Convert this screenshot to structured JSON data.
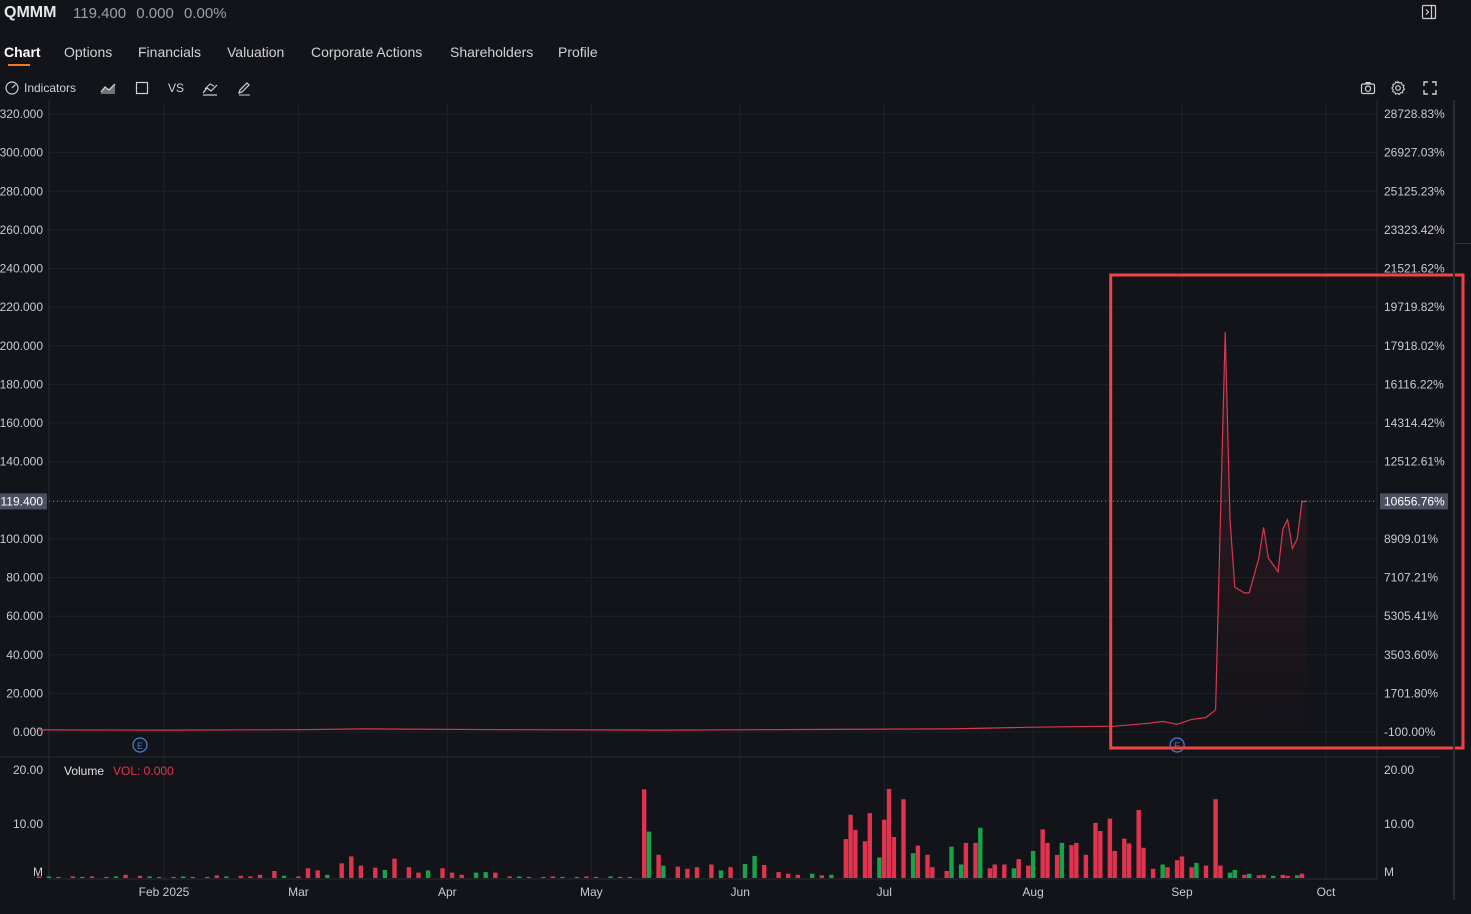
{
  "header": {
    "symbol": "QMMM",
    "price": "119.400",
    "change": "0.000",
    "change_pct": "0.00%"
  },
  "tabs": [
    {
      "label": "Chart",
      "active": true
    },
    {
      "label": "Options"
    },
    {
      "label": "Financials"
    },
    {
      "label": "Valuation"
    },
    {
      "label": "Corporate Actions"
    },
    {
      "label": "Shareholders"
    },
    {
      "label": "Profile"
    }
  ],
  "toolbar": {
    "indicators_label": "Indicators",
    "vs_label": "VS"
  },
  "colors": {
    "background": "#131419",
    "up": "#16a34a",
    "down": "#e0344e",
    "price_line": "#d9374f",
    "highlight_box": "#f04444",
    "earnings_marker": "#4d7fd6",
    "accent": "#f07a22"
  },
  "chart_data": {
    "type": "line",
    "x_ticks": [
      "Feb 2025",
      "Mar",
      "Apr",
      "May",
      "Jun",
      "Jul",
      "Aug",
      "Sep",
      "Oct"
    ],
    "ylim": [
      0,
      320
    ],
    "y_ticks_left": [
      "320.000",
      "300.000",
      "280.000",
      "260.000",
      "240.000",
      "220.000",
      "200.000",
      "180.000",
      "160.000",
      "140.000",
      "120.000",
      "100.000",
      "80.000",
      "60.000",
      "40.000",
      "20.000",
      "0.000"
    ],
    "y_ticks_right": [
      "28728.83%",
      "26927.03%",
      "25125.23%",
      "23323.42%",
      "21521.62%",
      "19719.82%",
      "17918.02%",
      "16116.22%",
      "14314.42%",
      "12512.61%",
      "10656.76%",
      "8909.01%",
      "7107.21%",
      "5305.41%",
      "3503.60%",
      "1701.80%",
      "-100.00%"
    ],
    "current_value_label": "119.400",
    "current_pct_label": "10656.76%",
    "current_value": 119.4,
    "earnings_marker_label": "E",
    "earnings_dates": [
      "2025-01-27",
      "2025-08-31"
    ],
    "series": [
      {
        "values": [
          {
            "date": "2025-01-06",
            "value": 1.1
          },
          {
            "date": "2025-02-01",
            "value": 1.0
          },
          {
            "date": "2025-03-01",
            "value": 1.2
          },
          {
            "date": "2025-03-15",
            "value": 1.6
          },
          {
            "date": "2025-04-15",
            "value": 1.2
          },
          {
            "date": "2025-05-15",
            "value": 1.0
          },
          {
            "date": "2025-06-15",
            "value": 1.3
          },
          {
            "date": "2025-07-15",
            "value": 1.6
          },
          {
            "date": "2025-08-01",
            "value": 2.5
          },
          {
            "date": "2025-08-18",
            "value": 3.0
          },
          {
            "date": "2025-08-25",
            "value": 4.5
          },
          {
            "date": "2025-08-28",
            "value": 5.5
          },
          {
            "date": "2025-08-31",
            "value": 4.0
          },
          {
            "date": "2025-09-03",
            "value": 6.5
          },
          {
            "date": "2025-09-06",
            "value": 7.5
          },
          {
            "date": "2025-09-08",
            "value": 11.5
          },
          {
            "date": "2025-09-09",
            "value": 110
          },
          {
            "date": "2025-09-10",
            "value": 207
          },
          {
            "date": "2025-09-11",
            "value": 110
          },
          {
            "date": "2025-09-12",
            "value": 75
          },
          {
            "date": "2025-09-14",
            "value": 72
          },
          {
            "date": "2025-09-15",
            "value": 72
          },
          {
            "date": "2025-09-17",
            "value": 90
          },
          {
            "date": "2025-09-18",
            "value": 106
          },
          {
            "date": "2025-09-19",
            "value": 90
          },
          {
            "date": "2025-09-21",
            "value": 83
          },
          {
            "date": "2025-09-22",
            "value": 105
          },
          {
            "date": "2025-09-23",
            "value": 110
          },
          {
            "date": "2025-09-24",
            "value": 95
          },
          {
            "date": "2025-09-25",
            "value": 100
          },
          {
            "date": "2025-09-26",
            "value": 119.4
          },
          {
            "date": "2025-09-27",
            "value": 119.4
          }
        ]
      }
    ],
    "highlight_range": {
      "start": "2025-08-18",
      "end": "2025-10-10"
    }
  },
  "volume": {
    "label": "Volume",
    "value_label": "VOL: 0.000",
    "ylim": [
      0,
      20
    ],
    "y_ticks_left": [
      "20.00",
      "10.00",
      "M"
    ],
    "y_ticks_right": [
      "20.00",
      "10.00",
      "M"
    ],
    "bars": [
      {
        "date": "2025-01-06",
        "value": 0.3,
        "dir": "down"
      },
      {
        "date": "2025-01-08",
        "value": 0.3,
        "dir": "up"
      },
      {
        "date": "2025-01-10",
        "value": 0.2,
        "dir": "down"
      },
      {
        "date": "2025-01-13",
        "value": 0.3,
        "dir": "down"
      },
      {
        "date": "2025-01-15",
        "value": 0.2,
        "dir": "up"
      },
      {
        "date": "2025-01-17",
        "value": 0.3,
        "dir": "down"
      },
      {
        "date": "2025-01-20",
        "value": 0.2,
        "dir": "down"
      },
      {
        "date": "2025-01-22",
        "value": 0.3,
        "dir": "up"
      },
      {
        "date": "2025-01-24",
        "value": 0.6,
        "dir": "down"
      },
      {
        "date": "2025-01-27",
        "value": 0.4,
        "dir": "down"
      },
      {
        "date": "2025-01-29",
        "value": 0.3,
        "dir": "up"
      },
      {
        "date": "2025-01-31",
        "value": 0.2,
        "dir": "down"
      },
      {
        "date": "2025-02-03",
        "value": 0.2,
        "dir": "down"
      },
      {
        "date": "2025-02-05",
        "value": 0.3,
        "dir": "up"
      },
      {
        "date": "2025-02-07",
        "value": 0.2,
        "dir": "down"
      },
      {
        "date": "2025-02-10",
        "value": 0.2,
        "dir": "down"
      },
      {
        "date": "2025-02-12",
        "value": 0.5,
        "dir": "down"
      },
      {
        "date": "2025-02-14",
        "value": 0.3,
        "dir": "up"
      },
      {
        "date": "2025-02-17",
        "value": 0.4,
        "dir": "down"
      },
      {
        "date": "2025-02-19",
        "value": 0.3,
        "dir": "down"
      },
      {
        "date": "2025-02-21",
        "value": 0.6,
        "dir": "down"
      },
      {
        "date": "2025-02-24",
        "value": 1.3,
        "dir": "down"
      },
      {
        "date": "2025-02-26",
        "value": 0.4,
        "dir": "up"
      },
      {
        "date": "2025-03-01",
        "value": 0.3,
        "dir": "down"
      },
      {
        "date": "2025-03-03",
        "value": 1.8,
        "dir": "down"
      },
      {
        "date": "2025-03-05",
        "value": 1.4,
        "dir": "down"
      },
      {
        "date": "2025-03-07",
        "value": 0.6,
        "dir": "up"
      },
      {
        "date": "2025-03-10",
        "value": 2.7,
        "dir": "down"
      },
      {
        "date": "2025-03-12",
        "value": 4.0,
        "dir": "down"
      },
      {
        "date": "2025-03-14",
        "value": 2.3,
        "dir": "down"
      },
      {
        "date": "2025-03-17",
        "value": 1.9,
        "dir": "down"
      },
      {
        "date": "2025-03-19",
        "value": 1.5,
        "dir": "up"
      },
      {
        "date": "2025-03-21",
        "value": 3.6,
        "dir": "down"
      },
      {
        "date": "2025-03-24",
        "value": 2.0,
        "dir": "down"
      },
      {
        "date": "2025-03-26",
        "value": 1.0,
        "dir": "down"
      },
      {
        "date": "2025-03-28",
        "value": 1.4,
        "dir": "up"
      },
      {
        "date": "2025-03-31",
        "value": 1.8,
        "dir": "down"
      },
      {
        "date": "2025-04-02",
        "value": 1.0,
        "dir": "down"
      },
      {
        "date": "2025-04-04",
        "value": 0.6,
        "dir": "down"
      },
      {
        "date": "2025-04-07",
        "value": 1.0,
        "dir": "up"
      },
      {
        "date": "2025-04-09",
        "value": 1.1,
        "dir": "up"
      },
      {
        "date": "2025-04-11",
        "value": 1.0,
        "dir": "down"
      },
      {
        "date": "2025-04-14",
        "value": 0.3,
        "dir": "down"
      },
      {
        "date": "2025-04-16",
        "value": 0.3,
        "dir": "up"
      },
      {
        "date": "2025-04-18",
        "value": 0.2,
        "dir": "down"
      },
      {
        "date": "2025-04-21",
        "value": 0.2,
        "dir": "down"
      },
      {
        "date": "2025-04-23",
        "value": 0.3,
        "dir": "down"
      },
      {
        "date": "2025-04-25",
        "value": 0.2,
        "dir": "up"
      },
      {
        "date": "2025-04-28",
        "value": 0.2,
        "dir": "down"
      },
      {
        "date": "2025-04-30",
        "value": 0.3,
        "dir": "down"
      },
      {
        "date": "2025-05-02",
        "value": 0.2,
        "dir": "down"
      },
      {
        "date": "2025-05-05",
        "value": 0.3,
        "dir": "up"
      },
      {
        "date": "2025-05-07",
        "value": 0.2,
        "dir": "down"
      },
      {
        "date": "2025-05-09",
        "value": 0.2,
        "dir": "down"
      },
      {
        "date": "2025-05-12",
        "value": 16.4,
        "dir": "down"
      },
      {
        "date": "2025-05-13",
        "value": 8.6,
        "dir": "up"
      },
      {
        "date": "2025-05-15",
        "value": 4.3,
        "dir": "down"
      },
      {
        "date": "2025-05-16",
        "value": 2.3,
        "dir": "up"
      },
      {
        "date": "2025-05-19",
        "value": 2.1,
        "dir": "down"
      },
      {
        "date": "2025-05-21",
        "value": 1.7,
        "dir": "down"
      },
      {
        "date": "2025-05-23",
        "value": 2.0,
        "dir": "down"
      },
      {
        "date": "2025-05-26",
        "value": 2.5,
        "dir": "down"
      },
      {
        "date": "2025-05-28",
        "value": 1.4,
        "dir": "up"
      },
      {
        "date": "2025-05-30",
        "value": 2.0,
        "dir": "down"
      },
      {
        "date": "2025-06-02",
        "value": 2.6,
        "dir": "up"
      },
      {
        "date": "2025-06-04",
        "value": 4.1,
        "dir": "up"
      },
      {
        "date": "2025-06-06",
        "value": 2.4,
        "dir": "down"
      },
      {
        "date": "2025-06-09",
        "value": 1.1,
        "dir": "down"
      },
      {
        "date": "2025-06-11",
        "value": 0.8,
        "dir": "down"
      },
      {
        "date": "2025-06-13",
        "value": 0.6,
        "dir": "down"
      },
      {
        "date": "2025-06-16",
        "value": 0.8,
        "dir": "up"
      },
      {
        "date": "2025-06-18",
        "value": 0.5,
        "dir": "down"
      },
      {
        "date": "2025-06-20",
        "value": 0.6,
        "dir": "up"
      },
      {
        "date": "2025-06-23",
        "value": 7.2,
        "dir": "down"
      },
      {
        "date": "2025-06-24",
        "value": 11.7,
        "dir": "down"
      },
      {
        "date": "2025-06-25",
        "value": 8.9,
        "dir": "down"
      },
      {
        "date": "2025-06-27",
        "value": 6.8,
        "dir": "down"
      },
      {
        "date": "2025-06-28",
        "value": 12.0,
        "dir": "down"
      },
      {
        "date": "2025-06-30",
        "value": 3.8,
        "dir": "up"
      },
      {
        "date": "2025-07-01",
        "value": 10.8,
        "dir": "down"
      },
      {
        "date": "2025-07-02",
        "value": 16.5,
        "dir": "down"
      },
      {
        "date": "2025-07-03",
        "value": 7.6,
        "dir": "down"
      },
      {
        "date": "2025-07-05",
        "value": 14.6,
        "dir": "down"
      },
      {
        "date": "2025-07-07",
        "value": 4.6,
        "dir": "up"
      },
      {
        "date": "2025-07-08",
        "value": 6.0,
        "dir": "down"
      },
      {
        "date": "2025-07-10",
        "value": 4.3,
        "dir": "down"
      },
      {
        "date": "2025-07-11",
        "value": 2.0,
        "dir": "down"
      },
      {
        "date": "2025-07-14",
        "value": 1.3,
        "dir": "down"
      },
      {
        "date": "2025-07-15",
        "value": 5.8,
        "dir": "up"
      },
      {
        "date": "2025-07-17",
        "value": 2.5,
        "dir": "up"
      },
      {
        "date": "2025-07-18",
        "value": 6.5,
        "dir": "down"
      },
      {
        "date": "2025-07-20",
        "value": 6.5,
        "dir": "down"
      },
      {
        "date": "2025-07-21",
        "value": 9.3,
        "dir": "up"
      },
      {
        "date": "2025-07-23",
        "value": 1.8,
        "dir": "down"
      },
      {
        "date": "2025-07-24",
        "value": 2.5,
        "dir": "down"
      },
      {
        "date": "2025-07-26",
        "value": 2.5,
        "dir": "down"
      },
      {
        "date": "2025-07-28",
        "value": 1.8,
        "dir": "up"
      },
      {
        "date": "2025-07-29",
        "value": 3.5,
        "dir": "down"
      },
      {
        "date": "2025-07-31",
        "value": 2.3,
        "dir": "down"
      },
      {
        "date": "2025-08-01",
        "value": 5.0,
        "dir": "up"
      },
      {
        "date": "2025-08-03",
        "value": 9.0,
        "dir": "down"
      },
      {
        "date": "2025-08-04",
        "value": 6.5,
        "dir": "down"
      },
      {
        "date": "2025-08-06",
        "value": 4.3,
        "dir": "down"
      },
      {
        "date": "2025-08-07",
        "value": 6.5,
        "dir": "up"
      },
      {
        "date": "2025-08-09",
        "value": 6.1,
        "dir": "down"
      },
      {
        "date": "2025-08-10",
        "value": 6.5,
        "dir": "down"
      },
      {
        "date": "2025-08-12",
        "value": 4.3,
        "dir": "down"
      },
      {
        "date": "2025-08-14",
        "value": 10.2,
        "dir": "down"
      },
      {
        "date": "2025-08-15",
        "value": 8.7,
        "dir": "down"
      },
      {
        "date": "2025-08-17",
        "value": 11.0,
        "dir": "down"
      },
      {
        "date": "2025-08-18",
        "value": 5.0,
        "dir": "down"
      },
      {
        "date": "2025-08-20",
        "value": 7.3,
        "dir": "down"
      },
      {
        "date": "2025-08-21",
        "value": 6.4,
        "dir": "down"
      },
      {
        "date": "2025-08-23",
        "value": 12.6,
        "dir": "down"
      },
      {
        "date": "2025-08-24",
        "value": 5.6,
        "dir": "down"
      },
      {
        "date": "2025-08-26",
        "value": 1.7,
        "dir": "down"
      },
      {
        "date": "2025-08-28",
        "value": 2.5,
        "dir": "up"
      },
      {
        "date": "2025-08-29",
        "value": 2.0,
        "dir": "down"
      },
      {
        "date": "2025-08-31",
        "value": 3.3,
        "dir": "down"
      },
      {
        "date": "2025-09-01",
        "value": 4.0,
        "dir": "down"
      },
      {
        "date": "2025-09-03",
        "value": 2.0,
        "dir": "down"
      },
      {
        "date": "2025-09-04",
        "value": 2.8,
        "dir": "up"
      },
      {
        "date": "2025-09-06",
        "value": 2.3,
        "dir": "down"
      },
      {
        "date": "2025-09-08",
        "value": 14.6,
        "dir": "down"
      },
      {
        "date": "2025-09-09",
        "value": 2.3,
        "dir": "down"
      },
      {
        "date": "2025-09-11",
        "value": 1.0,
        "dir": "up"
      },
      {
        "date": "2025-09-12",
        "value": 1.5,
        "dir": "up"
      },
      {
        "date": "2025-09-14",
        "value": 0.6,
        "dir": "down"
      },
      {
        "date": "2025-09-15",
        "value": 0.8,
        "dir": "up"
      },
      {
        "date": "2025-09-17",
        "value": 0.5,
        "dir": "down"
      },
      {
        "date": "2025-09-18",
        "value": 0.6,
        "dir": "down"
      },
      {
        "date": "2025-09-20",
        "value": 0.4,
        "dir": "up"
      },
      {
        "date": "2025-09-22",
        "value": 0.6,
        "dir": "down"
      },
      {
        "date": "2025-09-23",
        "value": 0.4,
        "dir": "down"
      },
      {
        "date": "2025-09-25",
        "value": 0.5,
        "dir": "up"
      },
      {
        "date": "2025-09-26",
        "value": 0.8,
        "dir": "down"
      }
    ]
  }
}
